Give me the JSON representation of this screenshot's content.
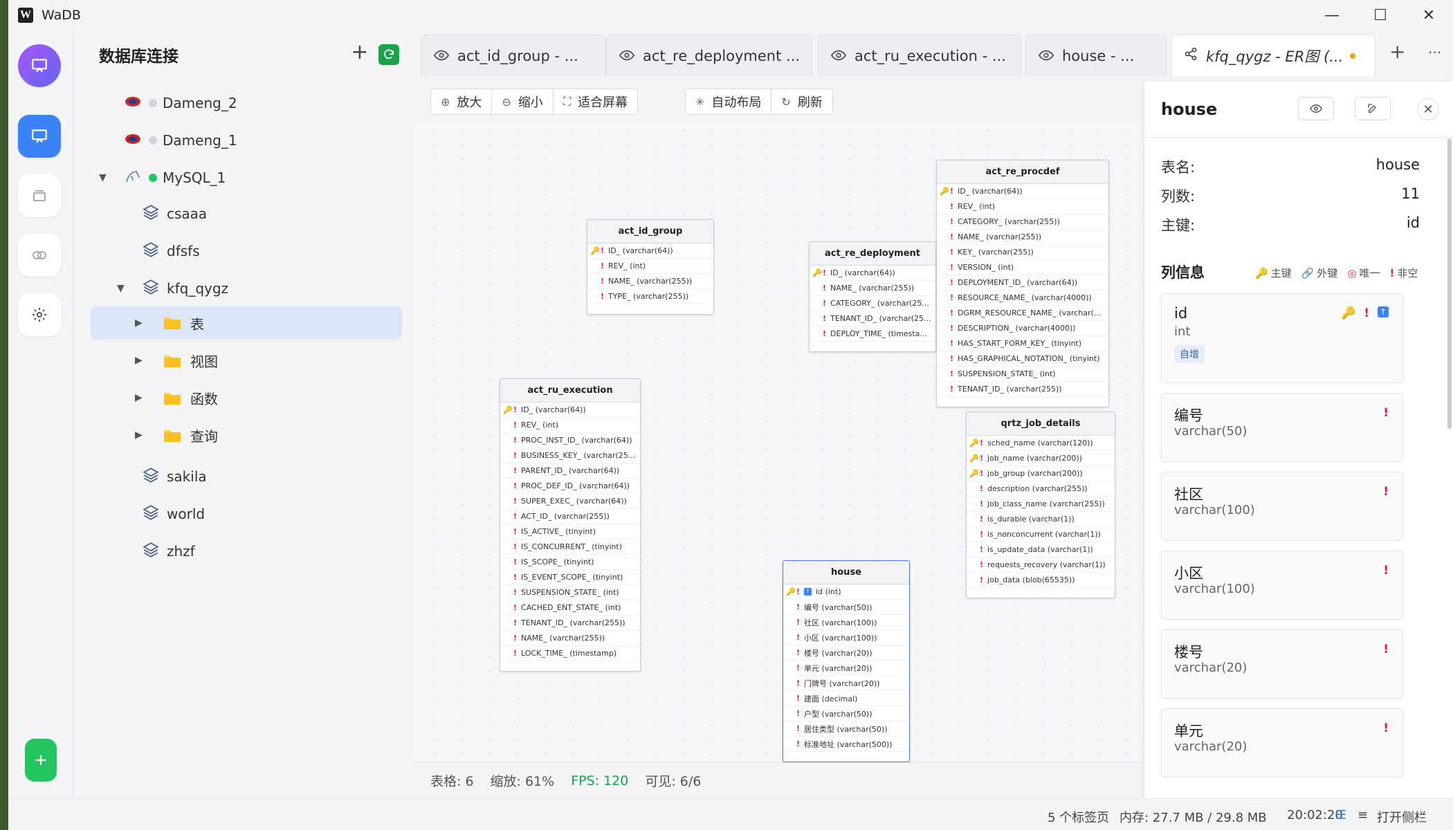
{
  "window": {
    "title": "WaDB",
    "controls": [
      "—",
      "☐",
      "✕"
    ]
  },
  "sidebar": {
    "header": "数据库连接",
    "add": "+",
    "tree": [
      {
        "label": "Dameng_2"
      },
      {
        "label": "Dameng_1"
      },
      {
        "label": "MySQL_1"
      },
      {
        "label": "csaaa"
      },
      {
        "label": "dfsfs"
      },
      {
        "label": "kfq_qygz"
      },
      {
        "label": "表"
      },
      {
        "label": "视图"
      },
      {
        "label": "函数"
      },
      {
        "label": "查询"
      },
      {
        "label": "sakila"
      },
      {
        "label": "world"
      },
      {
        "label": "zhzf"
      }
    ]
  },
  "tabs": [
    {
      "label": "act_id_group - ...",
      "icon": "eye-icon"
    },
    {
      "label": "act_re_deployment ...",
      "icon": "eye-icon"
    },
    {
      "label": "act_ru_execution - ...",
      "icon": "eye-icon"
    },
    {
      "label": "house - ...",
      "icon": "eye-icon"
    },
    {
      "label": "kfq_qygz - ER图 (...",
      "icon": "share-icon"
    }
  ],
  "tab_actions": {
    "add": "+",
    "more": "···"
  },
  "toolbar": {
    "zoom_in": "放大",
    "zoom_out": "缩小",
    "fit": "适合屏幕",
    "auto_layout": "自动布局",
    "refresh": "刷新"
  },
  "er": {
    "tables": [
      {
        "name": "act_id_group",
        "columns": [
          {
            "text": "ID_ (varchar(64))",
            "pk": true
          },
          {
            "text": "REV_ (int)"
          },
          {
            "text": "NAME_ (varchar(255))"
          },
          {
            "text": "TYPE_ (varchar(255))"
          }
        ]
      },
      {
        "name": "act_re_deployment",
        "columns": [
          {
            "text": "ID_ (varchar(64))",
            "pk": true
          },
          {
            "text": "NAME_ (varchar(255))"
          },
          {
            "text": "CATEGORY_ (varchar(25..."
          },
          {
            "text": "TENANT_ID_ (varchar(25..."
          },
          {
            "text": "DEPLOY_TIME_ (timesta..."
          }
        ]
      },
      {
        "name": "act_re_procdef",
        "columns": [
          {
            "text": "ID_ (varchar(64))",
            "pk": true
          },
          {
            "text": "REV_ (int)"
          },
          {
            "text": "CATEGORY_ (varchar(255))"
          },
          {
            "text": "NAME_ (varchar(255))"
          },
          {
            "text": "KEY_ (varchar(255))"
          },
          {
            "text": "VERSION_ (int)"
          },
          {
            "text": "DEPLOYMENT_ID_ (varchar(64))"
          },
          {
            "text": "RESOURCE_NAME_ (varchar(4000))"
          },
          {
            "text": "DGRM_RESOURCE_NAME_ (varchar(..."
          },
          {
            "text": "DESCRIPTION_ (varchar(4000))"
          },
          {
            "text": "HAS_START_FORM_KEY_ (tinyint)"
          },
          {
            "text": "HAS_GRAPHICAL_NOTATION_ (tinyint)"
          },
          {
            "text": "SUSPENSION_STATE_ (int)"
          },
          {
            "text": "TENANT_ID_ (varchar(255))"
          }
        ]
      },
      {
        "name": "act_ru_execution",
        "columns": [
          {
            "text": "ID_ (varchar(64))",
            "pk": true
          },
          {
            "text": "REV_ (int)"
          },
          {
            "text": "PROC_INST_ID_ (varchar(64))"
          },
          {
            "text": "BUSINESS_KEY_ (varchar(25..."
          },
          {
            "text": "PARENT_ID_ (varchar(64))"
          },
          {
            "text": "PROC_DEF_ID_ (varchar(64))"
          },
          {
            "text": "SUPER_EXEC_ (varchar(64))"
          },
          {
            "text": "ACT_ID_ (varchar(255))"
          },
          {
            "text": "IS_ACTIVE_ (tinyint)"
          },
          {
            "text": "IS_CONCURRENT_ (tinyint)"
          },
          {
            "text": "IS_SCOPE_ (tinyint)"
          },
          {
            "text": "IS_EVENT_SCOPE_ (tinyint)"
          },
          {
            "text": "SUSPENSION_STATE_ (int)"
          },
          {
            "text": "CACHED_ENT_STATE_ (int)"
          },
          {
            "text": "TENANT_ID_ (varchar(255))"
          },
          {
            "text": "NAME_ (varchar(255))"
          },
          {
            "text": "LOCK_TIME_ (timestamp)"
          }
        ]
      },
      {
        "name": "qrtz_job_details",
        "columns": [
          {
            "text": "sched_name (varchar(120))",
            "pk": true
          },
          {
            "text": "job_name (varchar(200))",
            "pk": true
          },
          {
            "text": "job_group (varchar(200))",
            "pk": true
          },
          {
            "text": "description (varchar(255))"
          },
          {
            "text": "job_class_name (varchar(255))"
          },
          {
            "text": "is_durable (varchar(1))"
          },
          {
            "text": "is_nonconcurrent (varchar(1))"
          },
          {
            "text": "is_update_data (varchar(1))"
          },
          {
            "text": "requests_recovery (varchar(1))"
          },
          {
            "text": "job_data (blob(65535))"
          }
        ]
      },
      {
        "name": "house",
        "columns": [
          {
            "text": "id (int)",
            "pk": true,
            "ai": true
          },
          {
            "text": "编号 (varchar(50))"
          },
          {
            "text": "社区 (varchar(100))"
          },
          {
            "text": "小区 (varchar(100))"
          },
          {
            "text": "楼号 (varchar(20))"
          },
          {
            "text": "单元 (varchar(20))"
          },
          {
            "text": "门牌号 (varchar(20))"
          },
          {
            "text": "建面 (decimal)"
          },
          {
            "text": "户型 (varchar(50))"
          },
          {
            "text": "居住类型 (varchar(50))"
          },
          {
            "text": "标准地址 (varchar(500))"
          }
        ]
      }
    ],
    "status": {
      "tables": "表格: 6",
      "zoom": "缩放: 61%",
      "fps": "FPS: 120",
      "visible": "可见: 6/6"
    }
  },
  "detail": {
    "title": "house",
    "meta": [
      {
        "label": "表名:",
        "value": "house"
      },
      {
        "label": "列数:",
        "value": "11"
      },
      {
        "label": "主键:",
        "value": "id"
      }
    ],
    "section": "列信息",
    "legend": [
      "主键",
      "外键",
      "唯一",
      "非空"
    ],
    "columns": [
      {
        "name": "id",
        "type": "int",
        "badge": "自增"
      },
      {
        "name": "编号",
        "type": "varchar(50)"
      },
      {
        "name": "社区",
        "type": "varchar(100)"
      },
      {
        "name": "小区",
        "type": "varchar(100)"
      },
      {
        "name": "楼号",
        "type": "varchar(20)"
      },
      {
        "name": "单元",
        "type": "varchar(20)"
      }
    ]
  },
  "statusbar": {
    "tabs": "5 个标签页",
    "memory": "内存: 27.7 MB / 29.8 MB",
    "time": "20:02:20",
    "toggle": "打开侧栏"
  },
  "colors": {
    "accent": "#3b82f6",
    "success": "#16a34a",
    "danger": "#e11d48",
    "key": "#d99a1a",
    "selected_row": "#dbe7f9"
  }
}
